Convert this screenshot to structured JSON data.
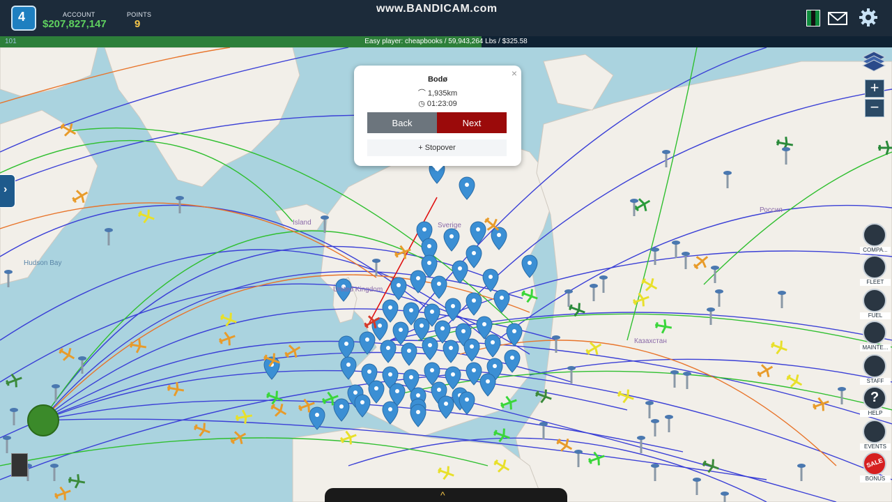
{
  "topbar": {
    "logo_text": "4",
    "account_label": "ACCOUNT",
    "account_value": "$207,827,147",
    "points_label": "POINTS",
    "points_value": "9",
    "watermark": "www.BANDICAM.com",
    "icons": [
      "flag-icon",
      "mail-icon",
      "gear-icon"
    ]
  },
  "status": {
    "id": "101",
    "text": "Easy player: cheapbooks / 59,943,264 Lbs / $325.58",
    "progress_fraction": 0.54
  },
  "map": {
    "labels": [
      "Island",
      "Sverige",
      "Russia_label",
      "United Kingdom",
      "Hudson Bay",
      "Kazakhstan"
    ],
    "label_text": {
      "island": "Island",
      "sverige": "Sverige",
      "rossiya": "Россия",
      "uk": "United Kingdom",
      "hudson": "Hudson Bay",
      "kazakhstan": "Казахстан"
    },
    "colors": {
      "water": "#aad3df",
      "land": "#f2efe9",
      "route_blue": "#3a3fd6",
      "route_green": "#2fbf2f",
      "route_orange": "#e8742a",
      "route_red": "#e01010",
      "marker": "#3b8fd4"
    }
  },
  "popup": {
    "title": "Bodø",
    "distance": "1,935km",
    "duration": "01:23:09",
    "close": "×",
    "back_label": "Back",
    "next_label": "Next",
    "stopover_label": "Stopover",
    "stopover_plus": "+"
  },
  "controls": {
    "zoom_in": "+",
    "zoom_out": "−",
    "side_toggle": "›",
    "bottom_tab": "^"
  },
  "menu": [
    {
      "label": "COMPA...",
      "icon": "company-icon"
    },
    {
      "label": "FLEET",
      "icon": "globe-icon"
    },
    {
      "label": "FUEL",
      "icon": "fuel-icon"
    },
    {
      "label": "MAINTE...",
      "icon": "wrench-icon"
    },
    {
      "label": "STAFF",
      "icon": "gauge-icon"
    },
    {
      "label": "HELP",
      "icon": "help-icon"
    },
    {
      "label": "EVENTS",
      "icon": "trophy-icon"
    },
    {
      "label": "BONUS",
      "icon": "sale-icon"
    }
  ],
  "bonus_badge": "SALE"
}
